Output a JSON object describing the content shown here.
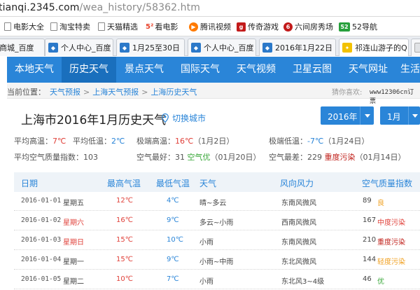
{
  "address": {
    "host": "tianqi.2345.com",
    "path": "/wea_history/58362.htm"
  },
  "bookmarks": [
    {
      "label": "电影大全",
      "icon": "page-icon",
      "color": ""
    },
    {
      "label": "淘宝特卖",
      "icon": "page-icon",
      "color": ""
    },
    {
      "label": "天猫精选",
      "icon": "page-icon",
      "color": ""
    },
    {
      "label": "看电影",
      "icon": "film-icon",
      "color": "#e8432c"
    },
    {
      "label": "腾讯视频",
      "icon": "tencent-video-icon",
      "color": "#ff7a00"
    },
    {
      "label": "传奇游戏",
      "icon": "game-icon",
      "color": "#c21a1a"
    },
    {
      "label": "六间房秀场",
      "icon": "liujianfang-icon",
      "color": "#c21a1a"
    },
    {
      "label": "52导航",
      "icon": "nav-icon",
      "color": "#27a03c"
    }
  ],
  "tabs": [
    {
      "label": "商城_百度"
    },
    {
      "label": "个人中心_百度"
    },
    {
      "label": "1月25至30日"
    },
    {
      "label": "个人中心_百度"
    },
    {
      "label": "2016年1月22日"
    },
    {
      "label": "祁连山游子的Q"
    },
    {
      "label": ""
    }
  ],
  "nav": {
    "items": [
      "本地天气",
      "历史天气",
      "景点天气",
      "国际天气",
      "天气视频",
      "卫星云图",
      "天气网址",
      "生活"
    ],
    "active_index": 1
  },
  "breadcrumb": {
    "prefix": "当前位置：",
    "items": [
      "天气预报",
      "上海天气预报",
      "上海历史天气"
    ],
    "separator": ">"
  },
  "ad": {
    "label": "猜你喜欢:",
    "text": "www12306cn订票",
    "link": "订票"
  },
  "page": {
    "title": "上海市2016年1月历史天气",
    "switch_city": "切换城市",
    "year": "2016年",
    "month": "1月"
  },
  "summary": {
    "avg_high_label": "平均高温：",
    "avg_high": "7℃",
    "avg_low_label": "平均低温：",
    "avg_low": "2℃",
    "max_high_label": "极端高温：",
    "max_high": "16℃",
    "max_high_date": "（1月2日）",
    "min_low_label": "极端低温：",
    "min_low": "-7℃",
    "min_low_date": "（1月24日）",
    "aqi_avg_label": "平均空气质量指数：",
    "aqi_avg": "103",
    "best_label": "空气最好：",
    "best_value": "31",
    "best_level": "空气优",
    "best_date": "（01月20日）",
    "worst_label": "空气最差：",
    "worst_value": "229",
    "worst_level": "重度污染",
    "worst_date": "（01月14日）"
  },
  "table": {
    "headers": [
      "日期",
      "最高气温",
      "最低气温",
      "天气",
      "风向风力",
      "空气质量指数"
    ],
    "rows": [
      {
        "date": "2016-01-01",
        "weekday": "星期五",
        "high": "12℃",
        "low": "4℃",
        "weather": "晴~多云",
        "wind": "东南风微风",
        "aqi": "89",
        "level": "良",
        "weekend": false,
        "level_color": "#f0a020"
      },
      {
        "date": "2016-01-02",
        "weekday": "星期六",
        "high": "16℃",
        "low": "9℃",
        "weather": "多云~小雨",
        "wind": "西南风微风",
        "aqi": "167",
        "level": "中度污染",
        "weekend": true,
        "level_color": "#e0413a"
      },
      {
        "date": "2016-01-03",
        "weekday": "星期日",
        "high": "15℃",
        "low": "10℃",
        "weather": "小雨",
        "wind": "东南风微风",
        "aqi": "210",
        "level": "重度污染",
        "weekend": true,
        "level_color": "#c0201a"
      },
      {
        "date": "2016-01-04",
        "weekday": "星期一",
        "high": "15℃",
        "low": "9℃",
        "weather": "小雨~中雨",
        "wind": "东北风微风",
        "aqi": "144",
        "level": "轻度污染",
        "weekend": false,
        "level_color": "#f0a020"
      },
      {
        "date": "2016-01-05",
        "weekday": "星期二",
        "high": "10℃",
        "low": "7℃",
        "weather": "小雨",
        "wind": "东北风3~4级",
        "aqi": "46",
        "level": "优",
        "weekend": false,
        "level_color": "#3aa83a"
      }
    ]
  },
  "colors": {
    "brand_blue": "#2a85d8",
    "high_temp": "#e0413a",
    "low_temp": "#2a85d8"
  }
}
